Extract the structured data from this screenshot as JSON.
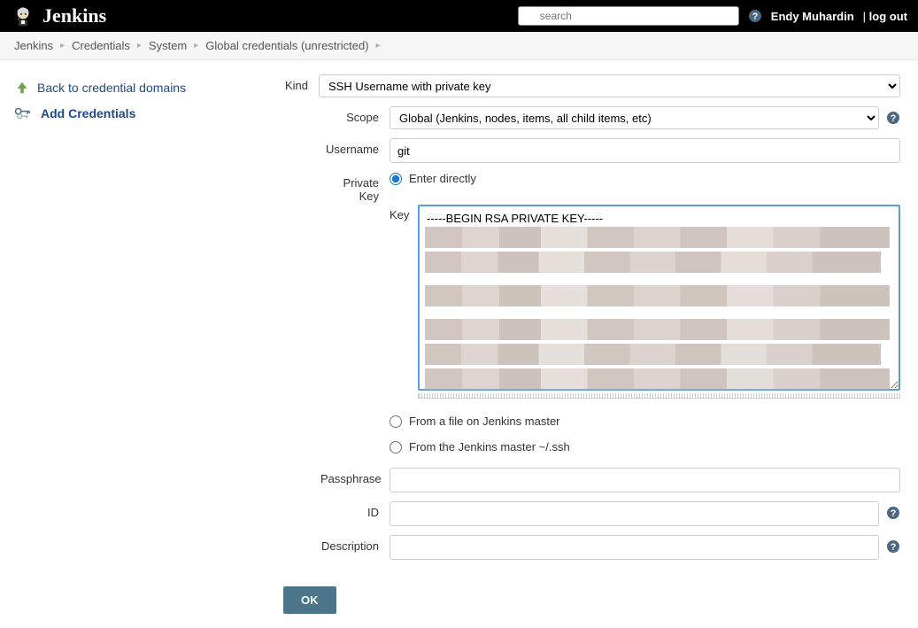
{
  "header": {
    "logo_text": "Jenkins",
    "search_placeholder": "search",
    "user_name": "Endy Muhardin",
    "logout_prefix": "| ",
    "logout_label": "log out"
  },
  "breadcrumb": {
    "items": [
      "Jenkins",
      "Credentials",
      "System",
      "Global credentials (unrestricted)"
    ]
  },
  "sidebar": {
    "back_label": "Back to credential domains",
    "add_label": "Add Credentials"
  },
  "form": {
    "kind_label": "Kind",
    "kind_value": "SSH Username with private key",
    "scope_label": "Scope",
    "scope_value": "Global (Jenkins, nodes, items, all child items, etc)",
    "username_label": "Username",
    "username_value": "git",
    "private_key_label": "Private Key",
    "radio_enter_directly": "Enter directly",
    "radio_from_file": "From a file on Jenkins master",
    "radio_from_ssh": "From the Jenkins master ~/.ssh",
    "key_label": "Key",
    "key_value": "-----BEGIN RSA PRIVATE KEY-----",
    "passphrase_label": "Passphrase",
    "passphrase_value": "",
    "id_label": "ID",
    "id_value": "",
    "description_label": "Description",
    "description_value": "",
    "ok_label": "OK"
  }
}
